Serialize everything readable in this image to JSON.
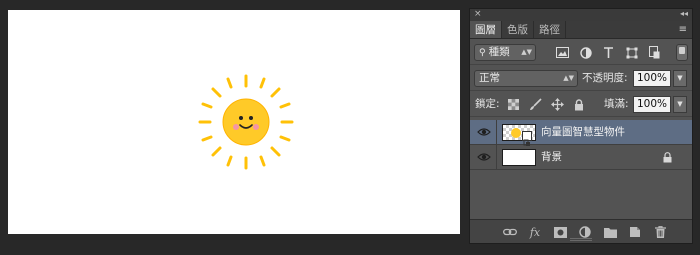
{
  "canvas": {
    "background": "#ffffff"
  },
  "sun": {
    "face": "#FFCA28",
    "rays": "#FFC107",
    "cheeks": "#F48FB1"
  },
  "panel": {
    "close_icon": "×",
    "collapse_icon": "◂◂",
    "tabs": [
      {
        "label": "圖層",
        "active": true
      },
      {
        "label": "色版",
        "active": false
      },
      {
        "label": "路徑",
        "active": false
      }
    ],
    "menu_icon": "≡",
    "filter": {
      "kind_label": "種類",
      "icons": [
        "image-filter-icon",
        "adjustment-filter-icon",
        "type-filter-icon",
        "shape-filter-icon",
        "smart-object-filter-icon"
      ]
    },
    "blend": {
      "mode": "正常",
      "opacity_label": "不透明度:",
      "opacity_value": "100%"
    },
    "lock": {
      "label": "鎖定:",
      "fill_label": "填滿:",
      "fill_value": "100%"
    },
    "layers": [
      {
        "name": "向量圖智慧型物件",
        "selected": true,
        "visible": true,
        "locked": false
      },
      {
        "name": "背景",
        "selected": false,
        "visible": true,
        "locked": true
      }
    ],
    "bottom_icons": [
      "link-layers-icon",
      "fx-icon",
      "mask-icon",
      "adjustment-layer-icon",
      "group-folder-icon",
      "new-layer-icon",
      "trash-icon"
    ],
    "colors": {
      "panel_bg": "#535353",
      "selected_row": "#5e6d84"
    }
  }
}
